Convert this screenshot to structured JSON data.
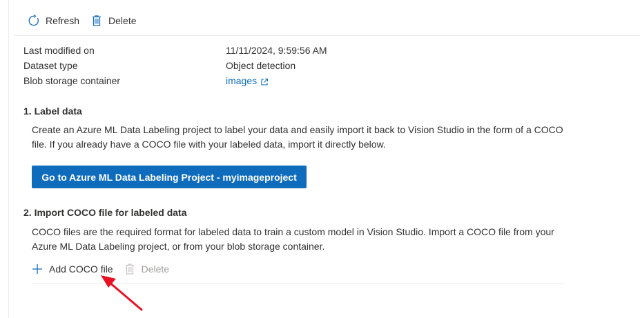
{
  "toolbar": {
    "refresh_label": "Refresh",
    "delete_label": "Delete"
  },
  "properties": [
    {
      "label": "Last modified on",
      "value": "11/11/2024, 9:59:56 AM"
    },
    {
      "label": "Dataset type",
      "value": "Object detection"
    },
    {
      "label": "Blob storage container",
      "value": "images"
    }
  ],
  "label_data": {
    "title": "1. Label data",
    "description": "Create an Azure ML Data Labeling project to label your data and easily import it back to Vision Studio in the form of a COCO file. If you already have a COCO file with your labeled data, import it directly below.",
    "button_label": "Go to Azure ML Data Labeling Project - myimageproject"
  },
  "import_coco": {
    "title": "2. Import COCO file for labeled data",
    "description": "COCO files are the required format for labeled data to train a custom model in Vision Studio. Import a COCO file from your Azure ML Data Labeling project, or from your blob storage container.",
    "add_label": "Add COCO file",
    "delete_label": "Delete"
  },
  "colors": {
    "accent": "#0f6cbd",
    "text": "#323130",
    "disabled": "#a19f9d",
    "annotation_arrow": "#e81123"
  },
  "icons": {
    "refresh": "refresh-icon",
    "delete": "trash-icon",
    "external_link": "external-link-icon",
    "add": "plus-icon"
  }
}
